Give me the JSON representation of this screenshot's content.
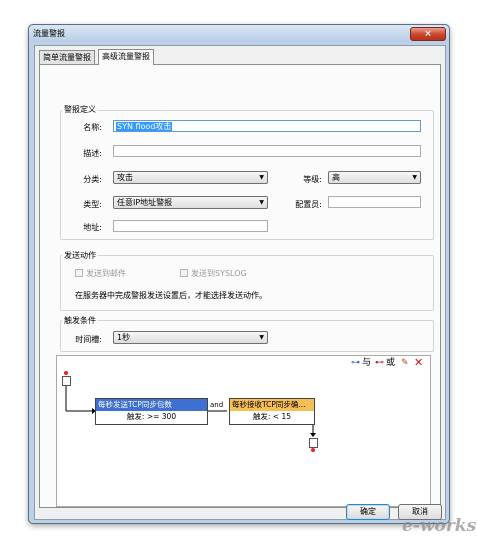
{
  "window": {
    "title": "流量警报",
    "close_glyph": "×"
  },
  "tabs": [
    {
      "label": "简单流量警报",
      "active": false
    },
    {
      "label": "高级流量警报",
      "active": true
    }
  ],
  "alarm_definition": {
    "legend": "警报定义",
    "name_label": "名称:",
    "name_value": "SYN flood攻击",
    "desc_label": "描述:",
    "desc_value": "",
    "category_label": "分类:",
    "category_value": "攻击",
    "level_label": "等级:",
    "level_value": "高",
    "type_label": "类型:",
    "type_value": "任意IP地址警报",
    "config_label": "配置员:",
    "config_value": "",
    "address_label": "地址:",
    "address_value": ""
  },
  "send_action": {
    "legend": "发送动作",
    "email_label": "发送到邮件",
    "syslog_label": "发送到SYSLOG",
    "notice": "在服务器中完成警报发送设置后，才能选择发送动作。"
  },
  "trigger": {
    "legend": "触发条件",
    "time_label": "时间槽:",
    "time_value": "1秒"
  },
  "toolbar": {
    "and_label": "与",
    "or_label": "或"
  },
  "flow": {
    "node1_title": "每秒发送TCP同步包数",
    "node1_cond": "触发: >= 300",
    "connector": "and",
    "node2_title": "每秒接收TCP同步确...",
    "node2_cond": "触发: < 15"
  },
  "buttons": {
    "ok": "确定",
    "cancel": "取消"
  },
  "watermark": "e-works",
  "colors": {
    "node1_head": "#3f6fd0",
    "node2_head": "#f6bf55",
    "selection": "#3399ff",
    "close": "#c9442b"
  }
}
